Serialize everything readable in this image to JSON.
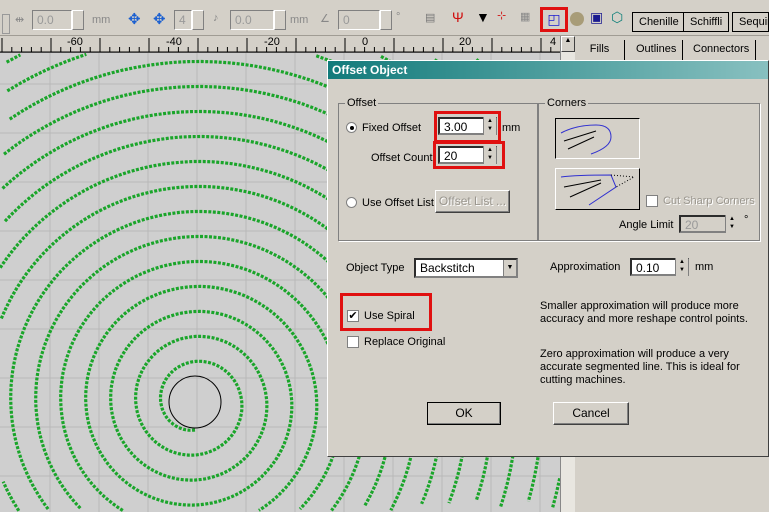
{
  "toolbar": {
    "spacing_value": "0.0",
    "spacing_unit": "mm",
    "count_value": "4",
    "length_value": "0.0",
    "length_unit": "mm",
    "angle_value": "0",
    "angle_unit": "°",
    "icons": [
      "spacing-icon",
      "move-nodes-icon",
      "duplicate-nodes-icon",
      "length-icon",
      "angle-icon",
      "stitch-icon",
      "needle-red-icon",
      "needle-icon",
      "node-add-icon",
      "pattern-icon",
      "offset-object-icon",
      "circle-icon",
      "maze-icon",
      "outline-icon"
    ],
    "tabs": [
      "Chenille",
      "Schiffli",
      "Sequin"
    ]
  },
  "ruler": {
    "ticks": [
      "-60",
      "-40",
      "-20",
      "0",
      "20",
      "4"
    ]
  },
  "right_tabs": [
    "Fills",
    "Outlines",
    "Connectors"
  ],
  "dialog": {
    "title": "Offset Object",
    "offset_group": "Offset",
    "fixed_offset_label": "Fixed Offset",
    "fixed_offset_value": "3.00",
    "fixed_offset_unit": "mm",
    "offset_count_label": "Offset Count",
    "offset_count_value": "20",
    "use_offset_list_label": "Use Offset List",
    "offset_list_button": "Offset List ...",
    "corners_group": "Corners",
    "cut_sharp_corners": "Cut Sharp Corners",
    "angle_limit_label": "Angle Limit",
    "angle_limit_value": "20",
    "angle_unit": "°",
    "object_type_label": "Object Type",
    "object_type_value": "Backstitch",
    "approximation_label": "Approximation",
    "approximation_value": "0.10",
    "approximation_unit": "mm",
    "use_spiral": "Use Spiral",
    "replace_original": "Replace Original",
    "hint1": "Smaller approximation will produce more accuracy and more reshape control points.",
    "hint2": "Zero approximation will produce a very accurate segmented line. This is ideal for cutting machines.",
    "ok": "OK",
    "cancel": "Cancel"
  },
  "colors": {
    "stitch": "#1aa52a",
    "highlight": "#e01010",
    "title": "#127b7b"
  }
}
